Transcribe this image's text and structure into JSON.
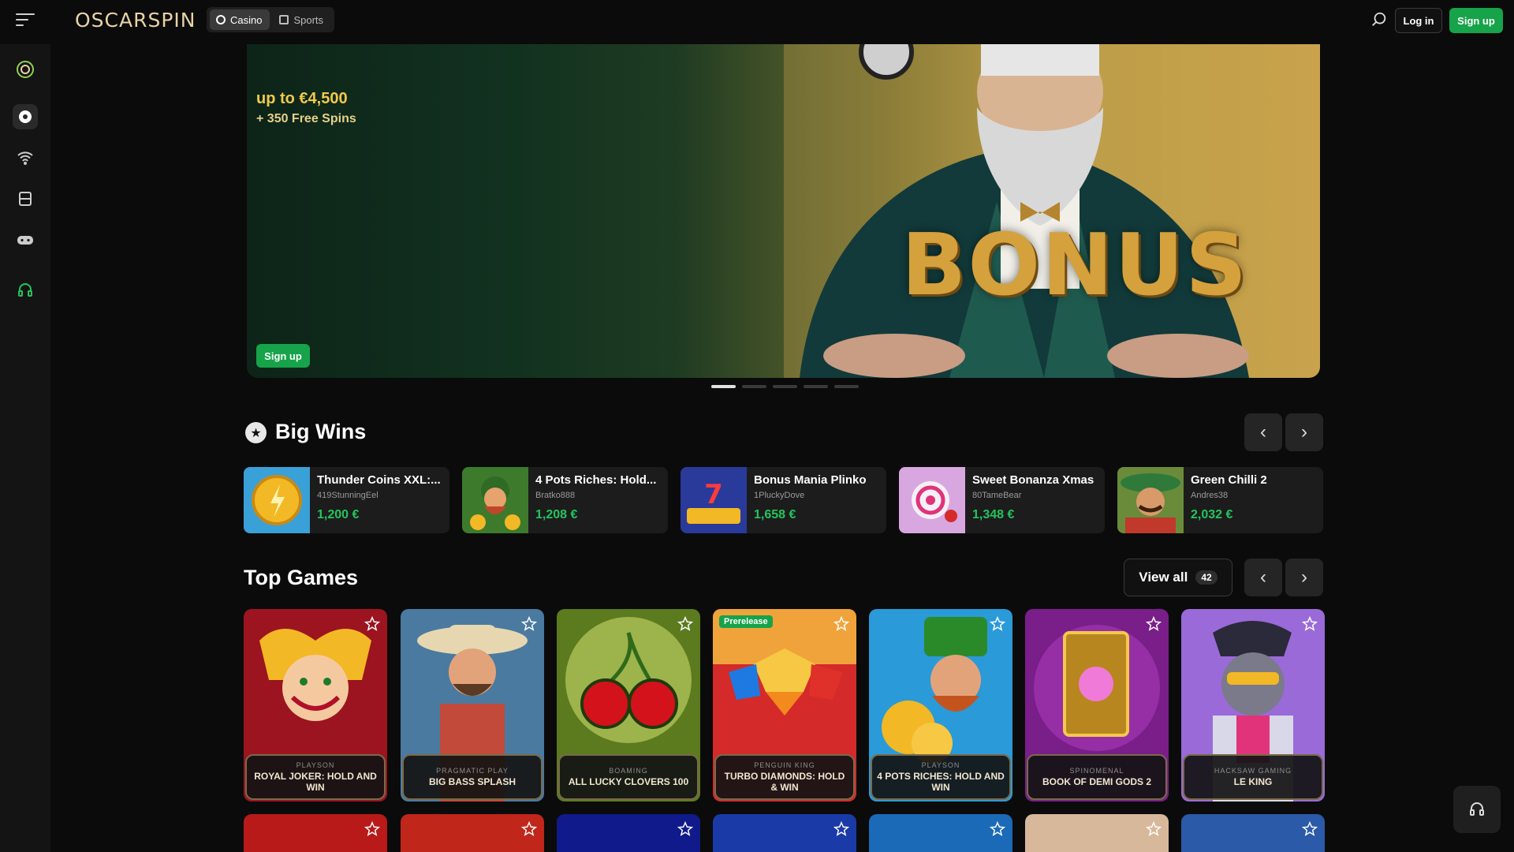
{
  "header": {
    "logo": "OSCARSPIN",
    "tabs": [
      {
        "label": "Casino",
        "active": true
      },
      {
        "label": "Sports",
        "active": false
      }
    ],
    "login_label": "Log in",
    "signup_label": "Sign up"
  },
  "sidebar": {
    "items": [
      {
        "icon": "logo-icon"
      },
      {
        "icon": "casino-chip-icon"
      },
      {
        "icon": "live-signal-icon"
      },
      {
        "icon": "sports-icon"
      },
      {
        "icon": "gamepad-icon"
      },
      {
        "icon": "support-headset-icon"
      }
    ]
  },
  "banner": {
    "amount": "up to €4,500",
    "spins": "+ 350 Free Spins",
    "art_text": "BONUS",
    "signup_label": "Sign up",
    "slides": 5,
    "active_slide": 1
  },
  "big_wins": {
    "title": "Big Wins",
    "items": [
      {
        "game": "Thunder Coins XXL:...",
        "user": "419StunningEel",
        "amount": "1,200 €"
      },
      {
        "game": "4 Pots Riches: Hold...",
        "user": "Bratko888",
        "amount": "1,208 €"
      },
      {
        "game": "Bonus Mania Plinko",
        "user": "1PluckyDove",
        "amount": "1,658 €"
      },
      {
        "game": "Sweet Bonanza Xmas",
        "user": "80TameBear",
        "amount": "1,348 €"
      },
      {
        "game": "Green Chilli 2",
        "user": "Andres38",
        "amount": "2,032 €"
      }
    ]
  },
  "top_games": {
    "title": "Top Games",
    "view_all_label": "View all",
    "view_all_count": "42",
    "items": [
      {
        "provider": "Playson",
        "name": "Royal Joker: Hold and Win"
      },
      {
        "provider": "Pragmatic Play",
        "name": "Big Bass Splash"
      },
      {
        "provider": "Boaming",
        "name": "All Lucky Clovers 100"
      },
      {
        "provider": "Penguin King",
        "name": "Turbo Diamonds: Hold & Win",
        "badge": "Prerelease"
      },
      {
        "provider": "Playson",
        "name": "4 Pots Riches: Hold and Win"
      },
      {
        "provider": "Spinomenal",
        "name": "Book of Demi Gods 2"
      },
      {
        "provider": "Hacksaw Gaming",
        "name": "Le King"
      }
    ]
  },
  "colors": {
    "accent_green": "#16a34a",
    "win_green": "#22c55e",
    "gold": "#f2c94c"
  }
}
